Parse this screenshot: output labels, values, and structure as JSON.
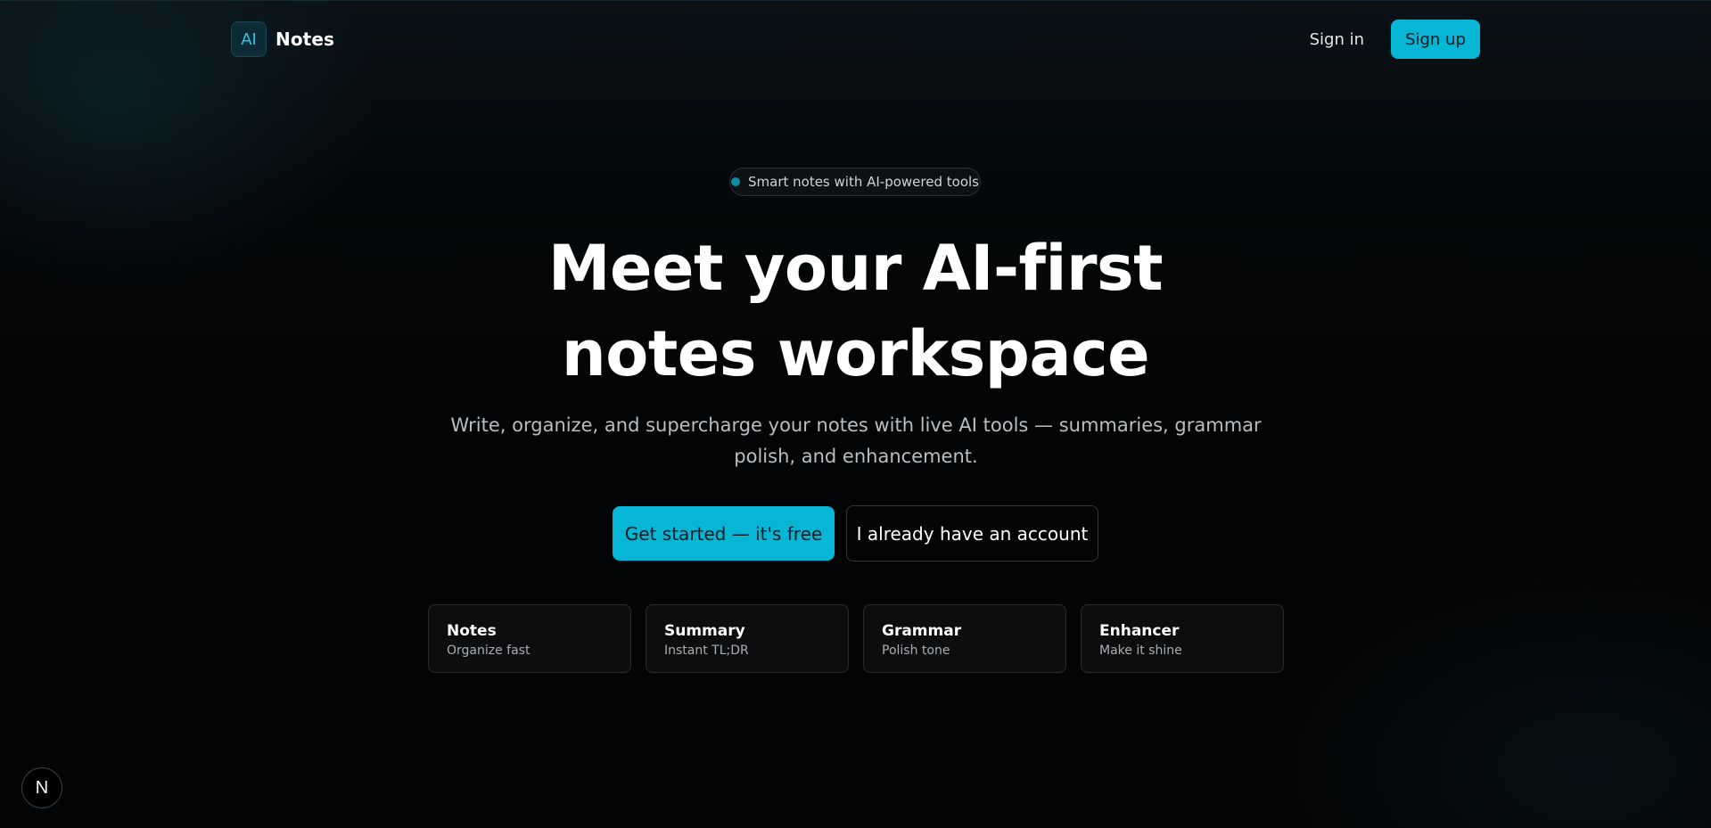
{
  "header": {
    "brand_badge": "AI",
    "brand_name": "Notes",
    "signin_label": "Sign in",
    "signup_label": "Sign up"
  },
  "pill": {
    "text": "Smart notes with AI-powered tools"
  },
  "hero": {
    "title_line1": "Meet your AI-first",
    "title_line2": "notes workspace",
    "subtitle": "Write, organize, and supercharge your notes with live AI tools — summaries, grammar polish, and enhancement."
  },
  "cta": {
    "primary_label": "Get started — it's free",
    "secondary_label": "I already have an account"
  },
  "features": [
    {
      "title": "Notes",
      "desc": "Organize fast"
    },
    {
      "title": "Summary",
      "desc": "Instant TL;DR"
    },
    {
      "title": "Grammar",
      "desc": "Polish tone"
    },
    {
      "title": "Enhancer",
      "desc": "Make it shine"
    }
  ],
  "dev_indicator": {
    "glyph": "N"
  },
  "colors": {
    "accent": "#06b6d4",
    "background": "#030405",
    "pill_dot": "#0b8fa7"
  }
}
